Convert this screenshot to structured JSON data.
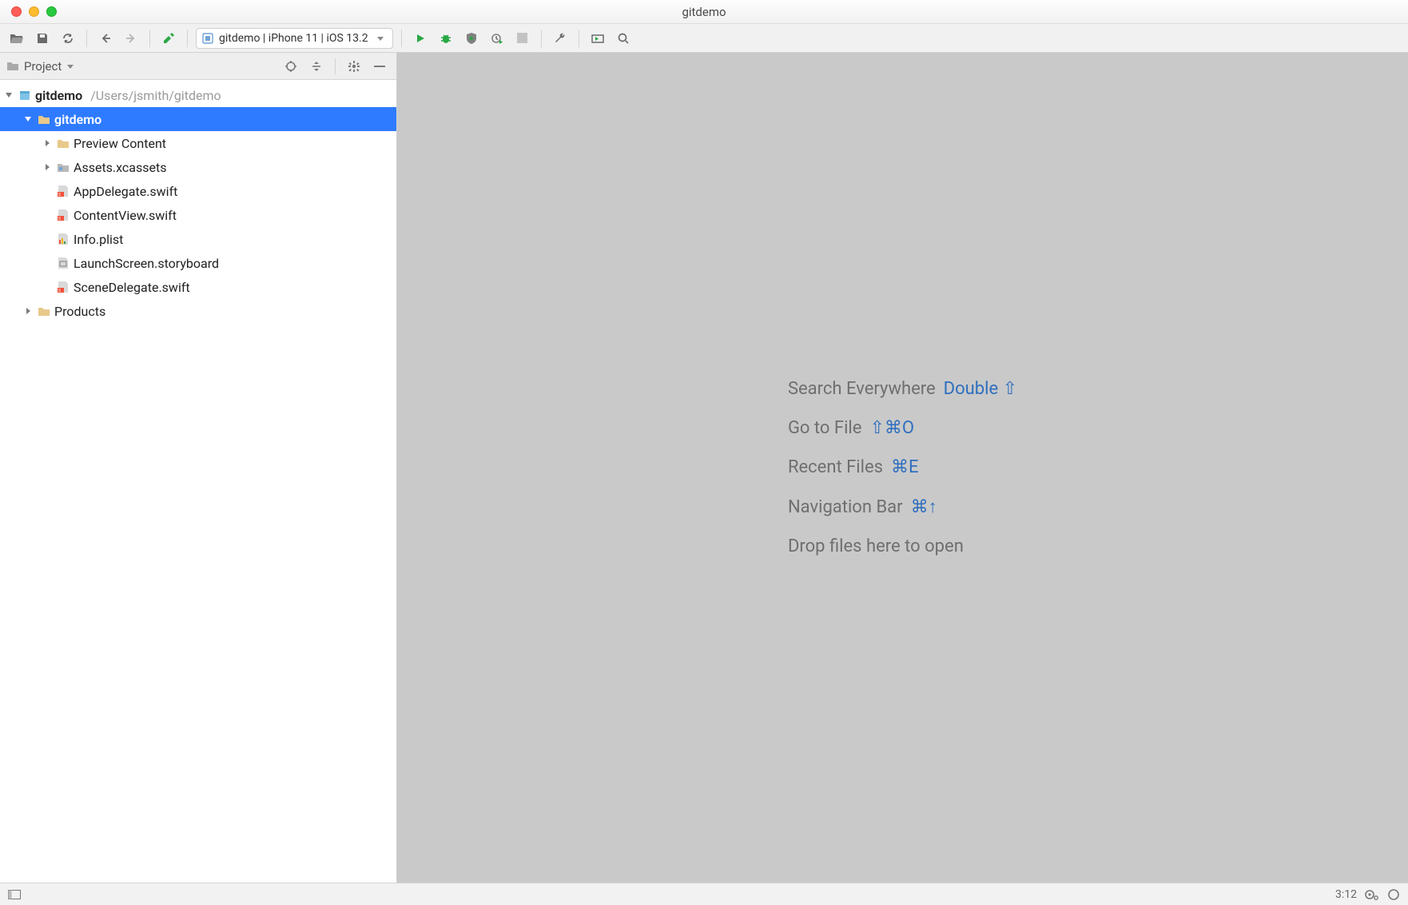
{
  "window": {
    "title": "gitdemo"
  },
  "toolbar": {
    "run_config": "gitdemo | iPhone 11 | iOS 13.2"
  },
  "project_panel": {
    "view_label": "Project",
    "root": {
      "name": "gitdemo",
      "path": "/Users/jsmith/gitdemo"
    },
    "module": {
      "name": "gitdemo"
    },
    "children": [
      {
        "name": "Preview Content",
        "kind": "folder",
        "expandable": true
      },
      {
        "name": "Assets.xcassets",
        "kind": "assets",
        "expandable": true
      },
      {
        "name": "AppDelegate.swift",
        "kind": "swift"
      },
      {
        "name": "ContentView.swift",
        "kind": "swift"
      },
      {
        "name": "Info.plist",
        "kind": "plist"
      },
      {
        "name": "LaunchScreen.storyboard",
        "kind": "storyboard"
      },
      {
        "name": "SceneDelegate.swift",
        "kind": "swift"
      }
    ],
    "products": {
      "name": "Products"
    }
  },
  "editor_tips": {
    "search_label": "Search Everywhere",
    "search_shortcut": "Double ⇧",
    "gotofile_label": "Go to File",
    "gotofile_shortcut": "⇧⌘O",
    "recent_label": "Recent Files",
    "recent_shortcut": "⌘E",
    "navbar_label": "Navigation Bar",
    "navbar_shortcut": "⌘↑",
    "drop_label": "Drop files here to open"
  },
  "statusbar": {
    "cursor": "3:12"
  }
}
